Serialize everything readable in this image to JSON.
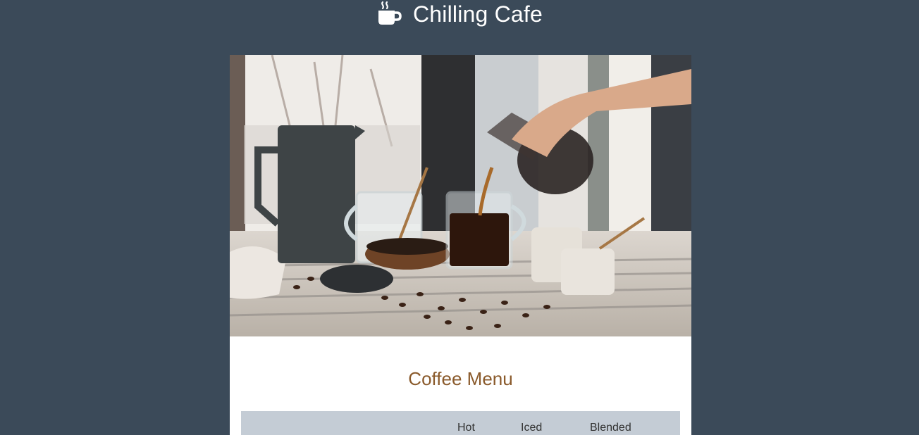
{
  "header": {
    "title": "Chilling Cafe",
    "icon": "coffee-cup-icon"
  },
  "hero": {
    "image": "coffee-pouring-photo"
  },
  "menu": {
    "title": "Coffee Menu",
    "columns": [
      "Hot",
      "Iced",
      "Blended"
    ]
  },
  "colors": {
    "background": "#3b4a59",
    "accent": "#8a5a2b",
    "table_header": "#c4ccd5"
  }
}
